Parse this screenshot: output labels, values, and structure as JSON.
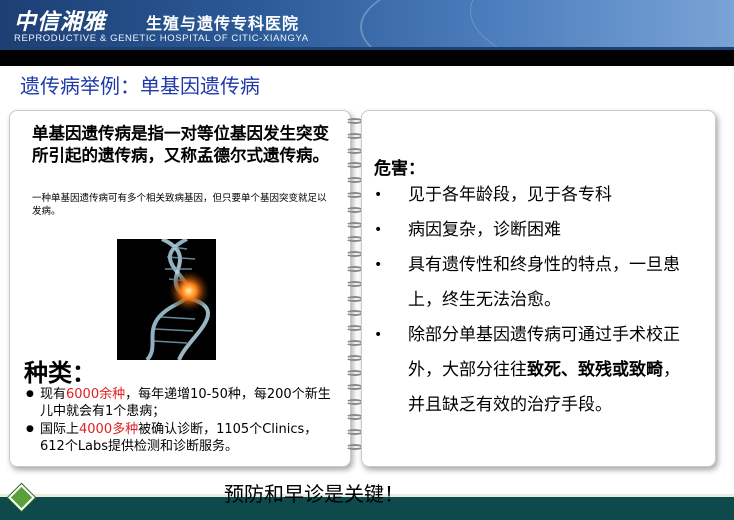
{
  "header": {
    "logo_cn": "中信湘雅",
    "hospital_cn": "生殖与遗传专科医院",
    "hospital_en": "REPRODUCTIVE & GENETIC HOSPITAL OF CITIC-XIANGYA"
  },
  "slide": {
    "title": "遗传病举例：单基因遗传病"
  },
  "left_card": {
    "definition": "单基因遗传病是指一对等位基因发生突变所引起的遗传病，又称孟德尔式遗传病。",
    "note": "一种单基因遗传病可有多个相关致病基因，但只要单个基因突变就足以发病。",
    "image_icon": "dna-helix-image",
    "types_title": "种类：",
    "types": [
      {
        "bullet": "●",
        "pre": "现有",
        "highlight": "6000余种",
        "post": "，每年递增10-50种，每200个新生儿中就会有1个患病；"
      },
      {
        "bullet": "●",
        "pre": "国际上",
        "highlight": "4000多种",
        "post": "被确认诊断，1105个Clinics，612个Labs提供检测和诊断服务。"
      }
    ],
    "highlight_color": "#e02020"
  },
  "right_card": {
    "title": "危害：",
    "items": [
      {
        "bullet": "•",
        "text": "见于各年龄段，见于各专科"
      },
      {
        "bullet": "•",
        "text": "病因复杂，诊断困难"
      },
      {
        "bullet": "•",
        "text": "具有遗传性和终身性的特点，一旦患上，终生无法治愈。"
      },
      {
        "bullet": "•",
        "pre": "除部分单基因遗传病可通过手术校正外，大部分往往",
        "bold": "致死、致残或致畸",
        "post": "，并且缺乏有效的治疗手段。"
      }
    ]
  },
  "footer": {
    "message": "预防和早诊是关键！",
    "band_color": "#0e4a4c",
    "diamond_color": "#5aa03a"
  }
}
